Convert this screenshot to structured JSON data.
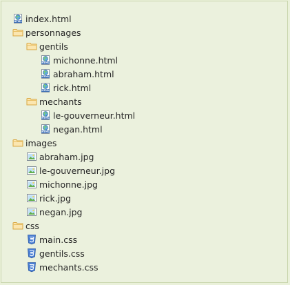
{
  "tree": {
    "items": [
      {
        "label": "index.html",
        "icon": "html-file-icon"
      },
      {
        "label": "personnages",
        "icon": "folder-icon"
      },
      {
        "label": "gentils",
        "icon": "folder-icon"
      },
      {
        "label": "michonne.html",
        "icon": "html-file-icon"
      },
      {
        "label": "abraham.html",
        "icon": "html-file-icon"
      },
      {
        "label": "rick.html",
        "icon": "html-file-icon"
      },
      {
        "label": "mechants",
        "icon": "folder-icon"
      },
      {
        "label": "le-gouverneur.html",
        "icon": "html-file-icon"
      },
      {
        "label": "negan.html",
        "icon": "html-file-icon"
      },
      {
        "label": "images",
        "icon": "folder-icon"
      },
      {
        "label": "abraham.jpg",
        "icon": "image-file-icon"
      },
      {
        "label": "le-gouverneur.jpg",
        "icon": "image-file-icon"
      },
      {
        "label": "michonne.jpg",
        "icon": "image-file-icon"
      },
      {
        "label": "rick.jpg",
        "icon": "image-file-icon"
      },
      {
        "label": "negan.jpg",
        "icon": "image-file-icon"
      },
      {
        "label": "css",
        "icon": "folder-icon"
      },
      {
        "label": "main.css",
        "icon": "css-file-icon"
      },
      {
        "label": "gentils.css",
        "icon": "css-file-icon"
      },
      {
        "label": "mechants.css",
        "icon": "css-file-icon"
      }
    ]
  },
  "colors": {
    "background": "#ebf1dd",
    "border": "#c9d6ad",
    "folder": "#f0c870",
    "css_badge": "#4a7fd4",
    "text": "#262626"
  }
}
